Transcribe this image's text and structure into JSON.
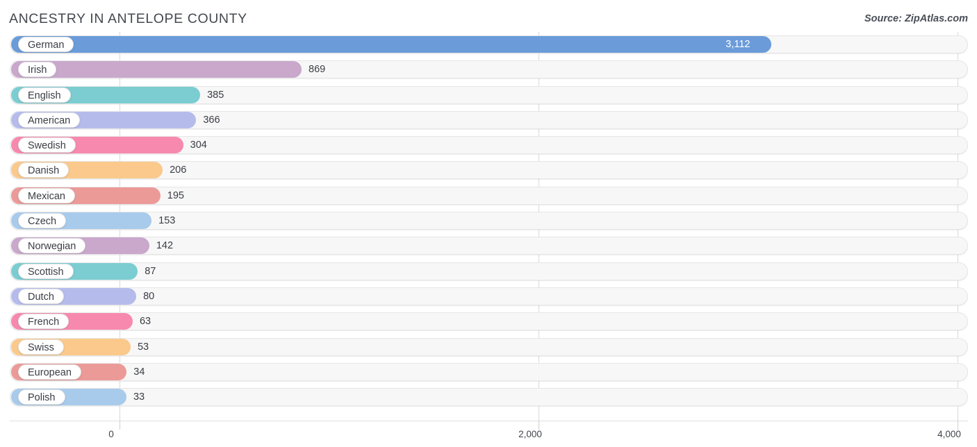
{
  "header": {
    "title": "ANCESTRY IN ANTELOPE COUNTY",
    "source": "Source: ZipAtlas.com"
  },
  "chart_data": {
    "type": "bar",
    "orientation": "horizontal",
    "title": "ANCESTRY IN ANTELOPE COUNTY",
    "xlabel": "",
    "ylabel": "",
    "xlim": [
      0,
      4000
    ],
    "grid": true,
    "legend": "none",
    "axis_ticks": [
      {
        "label": "0",
        "value": 0
      },
      {
        "label": "2,000",
        "value": 2000
      },
      {
        "label": "4,000",
        "value": 4000
      }
    ],
    "categories": [
      "German",
      "Irish",
      "English",
      "American",
      "Swedish",
      "Danish",
      "Mexican",
      "Czech",
      "Norwegian",
      "Scottish",
      "Dutch",
      "French",
      "Swiss",
      "European",
      "Polish"
    ],
    "values": [
      3112,
      869,
      385,
      366,
      304,
      206,
      195,
      153,
      142,
      87,
      80,
      63,
      53,
      34,
      33
    ],
    "value_labels": [
      "3,112",
      "869",
      "385",
      "366",
      "304",
      "206",
      "195",
      "153",
      "142",
      "87",
      "80",
      "63",
      "53",
      "34",
      "33"
    ],
    "colors": [
      "#6b9bd9",
      "#c9a8cc",
      "#7bcdd1",
      "#b5bcec",
      "#f789ae",
      "#fac98b",
      "#eb9a98",
      "#a8cbec",
      "#c9a8cc",
      "#7bcdd1",
      "#b5bcec",
      "#f789ae",
      "#fac98b",
      "#eb9a98",
      "#a8cbec"
    ]
  },
  "palette": {
    "blue": "#6b9bd9",
    "mauve": "#c9a8cc",
    "teal": "#7bcdd1",
    "lavender": "#b5bcec",
    "pink": "#f789ae",
    "orange": "#fac98b",
    "salmon": "#eb9a98",
    "lightblue": "#a8cbec",
    "track": "#f7f7f7",
    "gridline": "#d9d9d9",
    "text": "#3a3d44"
  }
}
